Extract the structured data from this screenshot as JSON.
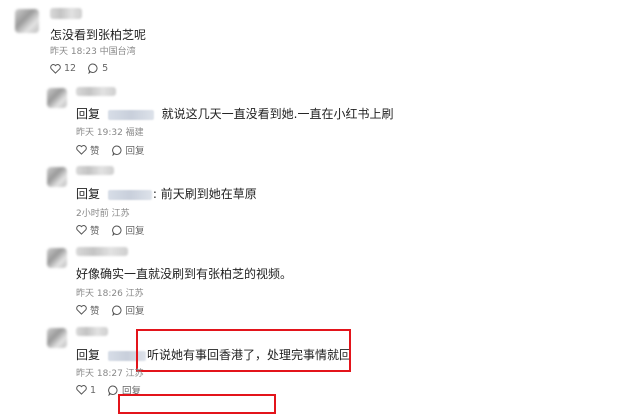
{
  "comments": [
    {
      "text": "怎没看到张柏芝呢",
      "meta": "昨天 18:23 中国台湾",
      "likes": "12",
      "replies": "5"
    },
    {
      "reply_prefix": "回复",
      "text": "就说这几天一直没看到她.一直在小红书上刷",
      "meta": "昨天 19:32 福建",
      "like_label": "赞",
      "reply_label": "回复"
    },
    {
      "reply_prefix": "回复",
      "text": ": 前天刷到她在草原",
      "meta": "2小时前 江苏",
      "like_label": "赞",
      "reply_label": "回复"
    },
    {
      "text": "好像确实一直就没刷到有张柏芝的视频。",
      "meta": "昨天 18:26 江苏",
      "like_label": "赞",
      "reply_label": "回复"
    },
    {
      "reply_prefix": "回复",
      "text": "听说她有事回香港了，处理完事情就回",
      "meta": "昨天 18:27 江苏",
      "likes": "1",
      "reply_label": "回复"
    }
  ],
  "colors": {
    "highlight_border": "#e3141b",
    "text": "#222222",
    "meta": "#888888"
  }
}
